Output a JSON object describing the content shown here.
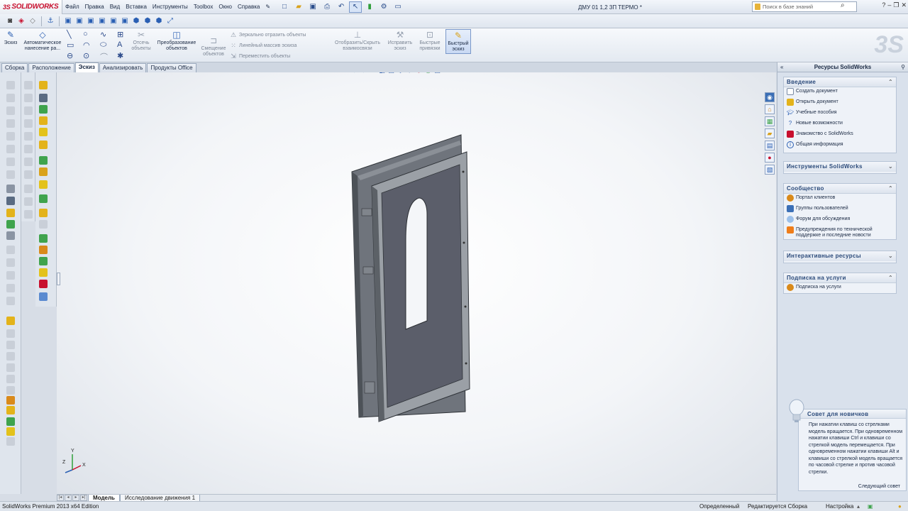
{
  "app": {
    "logo_text": "SOLIDWORKS",
    "logo_prefix": "3S",
    "document_title": "ДМУ 01 1,2 3П ТЕРМО *"
  },
  "menu": [
    "Файл",
    "Правка",
    "Вид",
    "Вставка",
    "Инструменты",
    "Toolbox",
    "Окно",
    "Справка"
  ],
  "search": {
    "placeholder": "Поиск в базе знаний"
  },
  "ribbon": {
    "sketch": "Эскиз",
    "smart_dim": "Автоматическое нанесение ра...",
    "trim": "Отсечь объекты",
    "convert": "Преобразование объектов",
    "offset": "Смещение объектов",
    "mirror": "Зеркально отразить объекты",
    "linear_pattern": "Линейный массив эскиза",
    "move": "Переместить объекты",
    "show_relations": "Отобразить/Скрыть взаимосвязи",
    "repair": "Исправить эскиз",
    "quick_snaps": "Быстрые привязки",
    "rapid_sketch": "Быстрый эскиз"
  },
  "tabs": [
    {
      "label": "Сборка",
      "active": false
    },
    {
      "label": "Расположение",
      "active": false
    },
    {
      "label": "Эскиз",
      "active": true
    },
    {
      "label": "Анализировать",
      "active": false
    },
    {
      "label": "Продукты Office",
      "active": false
    }
  ],
  "bottom_tabs": [
    {
      "label": "Модель",
      "active": true
    },
    {
      "label": "Исследование движения 1",
      "active": false
    }
  ],
  "status": {
    "edition": "SolidWorks Premium 2013 x64 Edition",
    "defined": "Определенный",
    "editing": "Редактируется Сборка",
    "settings": "Настройка"
  },
  "taskpane": {
    "title": "Ресурсы SolidWorks",
    "sections": {
      "intro": {
        "title": "Введение",
        "items": [
          "Создать документ",
          "Открыть документ",
          "Учебные пособия",
          "Новые возможности",
          "Знакомство с SolidWorks",
          "Общая информация"
        ]
      },
      "tools": {
        "title": "Инструменты SolidWorks"
      },
      "community": {
        "title": "Сообщество",
        "items": [
          "Портал клиентов",
          "Группы пользователей",
          "Форум для обсуждения",
          "Предупреждения по технической поддержке и последние новости"
        ]
      },
      "interactive": {
        "title": "Интерактивные ресурсы"
      },
      "subscription": {
        "title": "Подписка на услуги",
        "items": [
          "Подписка на услуги"
        ]
      }
    },
    "tip": {
      "title": "Совет для новичков",
      "text": "При нажатии клавиш со стрелками модель вращается. При одновременном нажатии клавиши Ctrl и клавиши со стрелкой модель перемещается. При одновременном нажатии клавиши Alt и клавиши со стрелкой модель вращается по часовой стрелке и против часовой стрелки.",
      "next": "Следующий совет"
    }
  },
  "triad": {
    "x": "X",
    "y": "Y",
    "z": "Z"
  },
  "colors": {
    "accent": "#2a5fb3",
    "brand_red": "#c8102e",
    "panel": "#d9e1ec"
  }
}
